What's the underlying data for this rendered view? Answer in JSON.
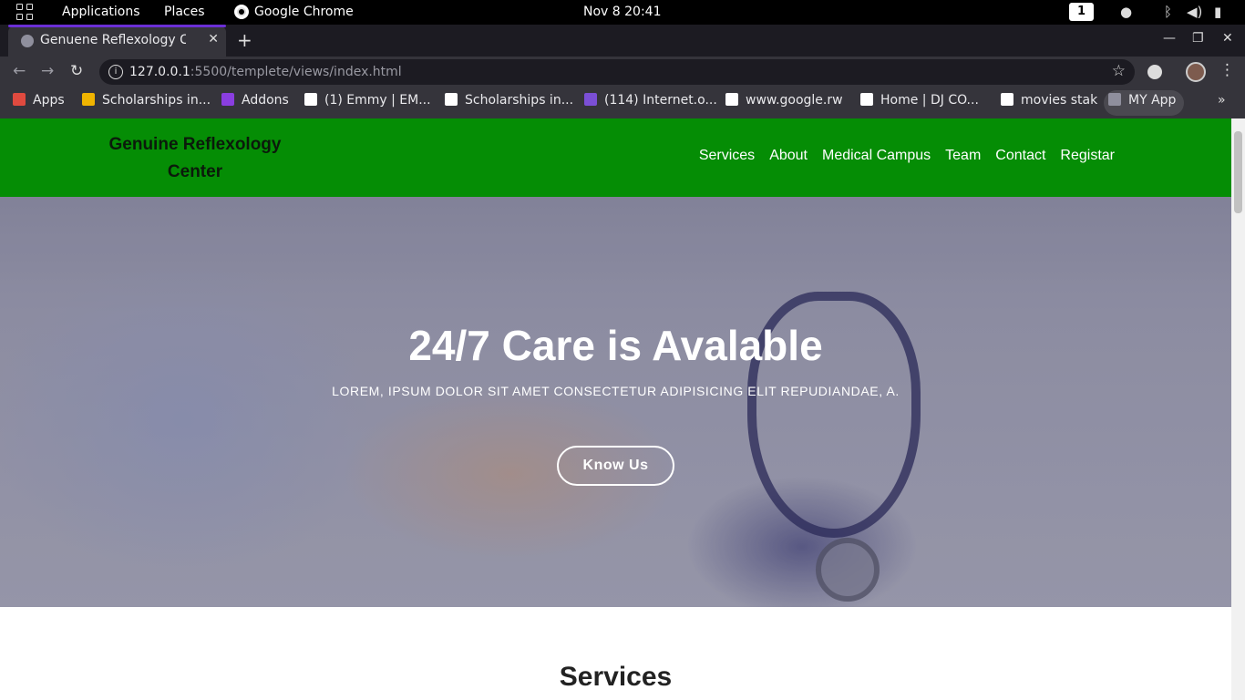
{
  "topbar": {
    "applications": "Applications",
    "places": "Places",
    "app_name": "Google Chrome",
    "datetime": "Nov 8  20:41",
    "workspace": "1"
  },
  "browser": {
    "tab_title": "Genuene Reflexology Cen",
    "url_host": "127.0.0.1",
    "url_path": ":5500/templete/views/index.html"
  },
  "bookmarks": [
    {
      "label": "Apps",
      "icon": "apps-grid-icon",
      "color": "#e04a3f"
    },
    {
      "label": "Scholarships in...",
      "icon": "flag-icon",
      "color": "#f0b400"
    },
    {
      "label": "Addons",
      "icon": "addons-icon",
      "color": "#8a3ee0"
    },
    {
      "label": "(1) Emmy | EM...",
      "icon": "a-logo-icon",
      "color": "#ffffff"
    },
    {
      "label": "Scholarships in...",
      "icon": "google-icon",
      "color": "#ffffff"
    },
    {
      "label": "(114) Internet.o...",
      "icon": "facebook-icon",
      "color": "#7b4fd6"
    },
    {
      "label": "www.google.rw",
      "icon": "google-icon",
      "color": "#ffffff"
    },
    {
      "label": "Home | DJ CO...",
      "icon": "wix-icon",
      "color": "#ffffff"
    },
    {
      "label": "movies stak",
      "icon": "movies-icon",
      "color": "#ffffff"
    },
    {
      "label": "MY App",
      "icon": "globe-icon",
      "color": "#8f8f9d"
    }
  ],
  "site": {
    "brand_line1": "Genuine Reflexology",
    "brand_line2": "Center",
    "nav": [
      "Services",
      "About",
      "Medical Campus",
      "Team",
      "Contact",
      "Registar"
    ],
    "header_color": "#058d05",
    "hero_title": "24/7 Care is Avalable",
    "hero_subtitle": "LOREM, IPSUM DOLOR SIT AMET CONSECTETUR ADIPISICING ELIT REPUDIANDAE, A.",
    "hero_button": "Know Us",
    "section_title": "Services"
  }
}
